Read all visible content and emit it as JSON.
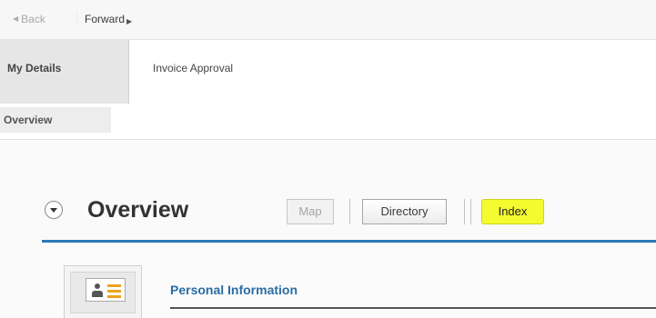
{
  "history": {
    "back_label": "Back",
    "forward_label": "Forward"
  },
  "main_tabs": [
    {
      "label": "My Details",
      "selected": true
    },
    {
      "label": "Invoice Approval",
      "selected": false
    }
  ],
  "sub_tabs": [
    {
      "label": "Overview",
      "selected": true
    }
  ],
  "page": {
    "title": "Overview"
  },
  "view_buttons": {
    "map": "Map",
    "directory": "Directory",
    "index": "Index"
  },
  "section": {
    "title": "Personal Information",
    "icon": "contact-card-icon"
  },
  "colors": {
    "accent_blue": "#2c77b5",
    "link_blue": "#2b6ca3",
    "highlight_yellow": "#f4fb2e"
  }
}
